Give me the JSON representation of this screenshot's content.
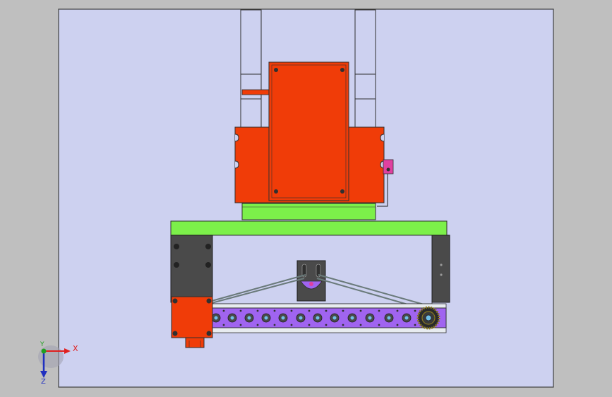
{
  "triad": {
    "x_label": "X",
    "y_label": "Y",
    "z_label": "Z"
  },
  "colors": {
    "background": "#bfbfbf",
    "viewport": "#cdd1f0",
    "machine_body": "#f03c08",
    "base_plate": "#7cf04a",
    "roller_track": "#a064f0",
    "side_block": "#4a4a4a",
    "connector": "#e040a0",
    "axis_x": "#e02020",
    "axis_y": "#20a020",
    "axis_z": "#2030c0"
  }
}
